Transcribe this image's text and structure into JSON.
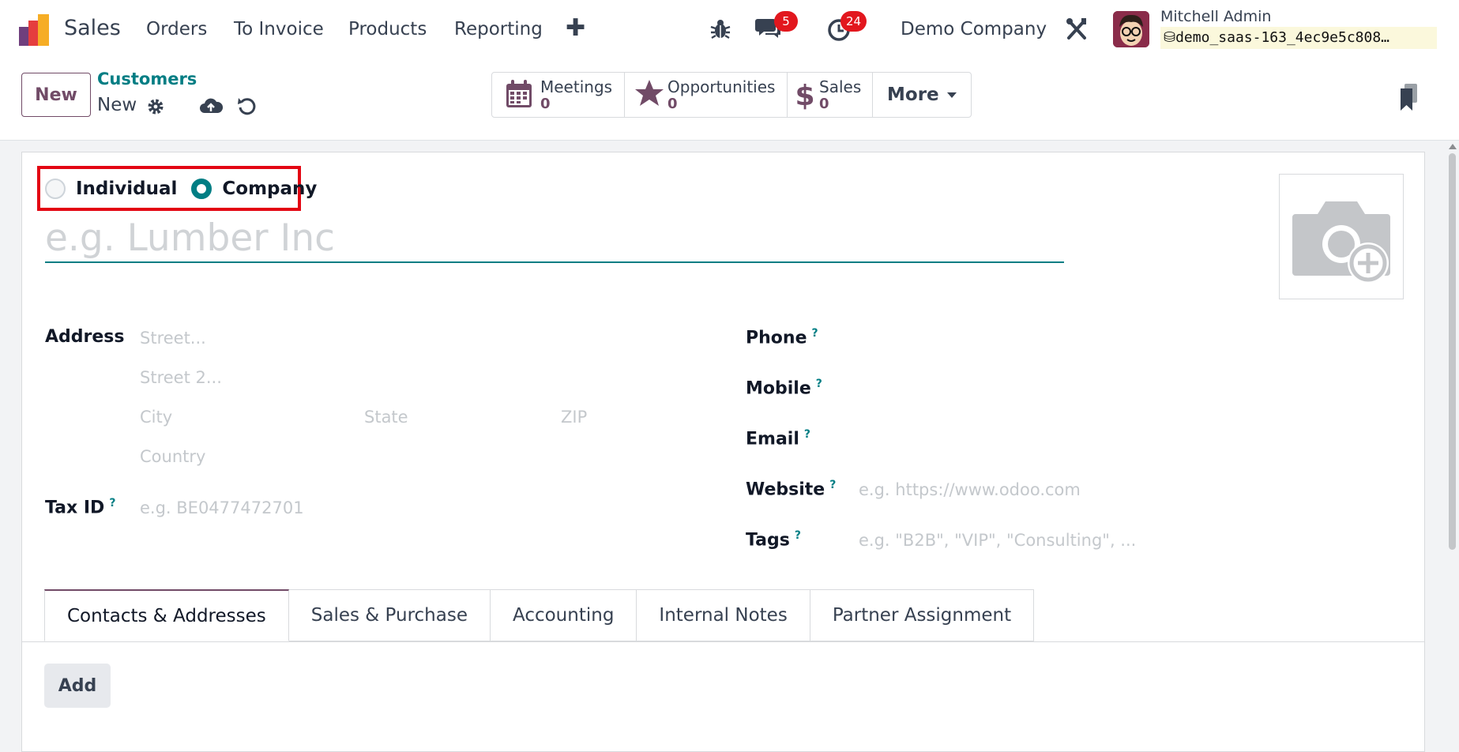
{
  "navbar": {
    "app_name": "Sales",
    "menu": [
      "Orders",
      "To Invoice",
      "Products",
      "Reporting"
    ],
    "messages_count": "5",
    "activities_count": "24",
    "company": "Demo Company",
    "user_name": "Mitchell Admin",
    "database": "demo_saas-163_4ec9e5c808…"
  },
  "control": {
    "new_label": "New",
    "breadcrumb_parent": "Customers",
    "breadcrumb_current": "New",
    "stats": [
      {
        "label": "Meetings",
        "value": "0",
        "icon": "calendar-icon"
      },
      {
        "label": "Opportunities",
        "value": "0",
        "icon": "star-icon"
      },
      {
        "label": "Sales",
        "value": "0",
        "icon": "dollar-icon"
      }
    ],
    "more_label": "More"
  },
  "form": {
    "type_options": [
      "Individual",
      "Company"
    ],
    "selected_type": "Company",
    "name_placeholder": "e.g. Lumber Inc",
    "address_label": "Address",
    "street_placeholder": "Street...",
    "street2_placeholder": "Street 2...",
    "city_placeholder": "City",
    "state_placeholder": "State",
    "zip_placeholder": "ZIP",
    "country_placeholder": "Country",
    "tax_id_label": "Tax ID",
    "tax_id_placeholder": "e.g. BE0477472701",
    "phone_label": "Phone",
    "mobile_label": "Mobile",
    "email_label": "Email",
    "website_label": "Website",
    "website_placeholder": "e.g. https://www.odoo.com",
    "tags_label": "Tags",
    "tags_placeholder": "e.g. \"B2B\", \"VIP\", \"Consulting\", ...",
    "help_mark": "?"
  },
  "tabs": [
    "Contacts & Addresses",
    "Sales & Purchase",
    "Accounting",
    "Internal Notes",
    "Partner Assignment"
  ],
  "add_label": "Add",
  "colors": {
    "brand": "#714b67",
    "accent": "#017e84",
    "badge": "#e2171e",
    "highlight": "#e30613"
  }
}
